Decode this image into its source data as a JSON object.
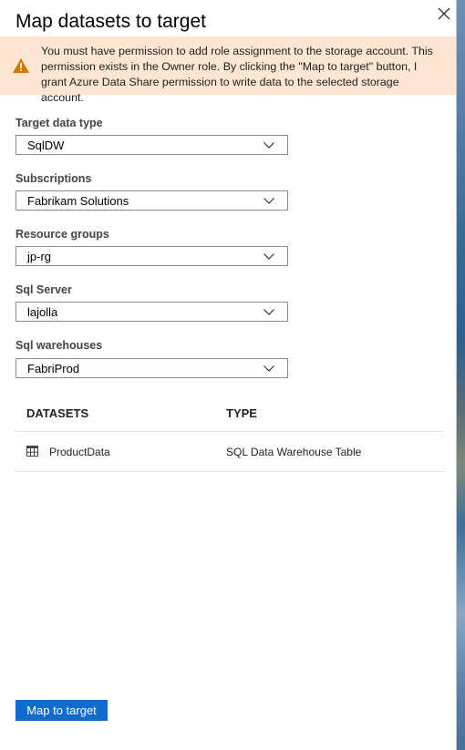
{
  "header": {
    "title": "Map datasets to target"
  },
  "warning": {
    "icon": "warning-icon",
    "text": "You must have permission to add role assignment to the storage account. This permission exists in the Owner role. By clicking the \"Map to target\" button, I grant Azure Data Share permission to write data to the selected storage account."
  },
  "fields": [
    {
      "label": "Target data type",
      "value": "SqlDW"
    },
    {
      "label": "Subscriptions",
      "value": "Fabrikam Solutions"
    },
    {
      "label": "Resource groups",
      "value": "jp-rg"
    },
    {
      "label": "Sql Server",
      "value": "lajolla"
    },
    {
      "label": "Sql warehouses",
      "value": "FabriProd"
    }
  ],
  "table": {
    "headers": [
      "DATASETS",
      "TYPE"
    ],
    "rows": [
      {
        "icon": "table-icon",
        "name": "ProductData",
        "type": "SQL Data Warehouse Table"
      }
    ]
  },
  "footer": {
    "map_button_label": "Map to target"
  },
  "colors": {
    "accent": "#0f6ccf",
    "warning_bg": "#fde7d2",
    "warning_icon": "#d47500"
  }
}
